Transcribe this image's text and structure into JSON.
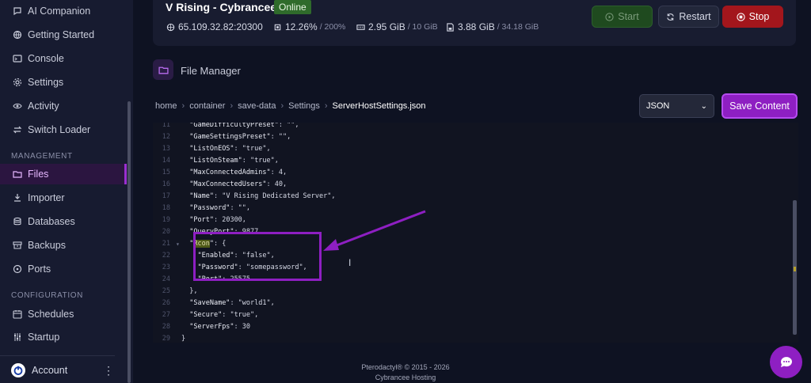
{
  "sidebar": {
    "items_top": [
      {
        "label": "AI Companion",
        "icon": "chat-icon"
      },
      {
        "label": "Getting Started",
        "icon": "globe-icon"
      },
      {
        "label": "Console",
        "icon": "terminal-icon"
      },
      {
        "label": "Settings",
        "icon": "gear-icon"
      },
      {
        "label": "Activity",
        "icon": "eye-icon"
      },
      {
        "label": "Switch Loader",
        "icon": "switch-icon"
      }
    ],
    "management_label": "MANAGEMENT",
    "items_management": [
      {
        "label": "Files",
        "icon": "folder-icon",
        "active": true
      },
      {
        "label": "Importer",
        "icon": "download-icon"
      },
      {
        "label": "Databases",
        "icon": "database-icon"
      },
      {
        "label": "Backups",
        "icon": "archive-icon"
      },
      {
        "label": "Ports",
        "icon": "network-icon"
      }
    ],
    "configuration_label": "CONFIGURATION",
    "items_configuration": [
      {
        "label": "Schedules",
        "icon": "calendar-icon"
      },
      {
        "label": "Startup",
        "icon": "sliders-icon"
      }
    ],
    "account_label": "Account"
  },
  "server": {
    "name": "V Rising - Cybrancee",
    "status": "Online",
    "address": "65.109.32.82:20300",
    "cpu": "12.26%",
    "cpu_limit": "/ 200%",
    "memory": "2.95 GiB",
    "memory_limit": "/ 10 GiB",
    "disk": "3.88 GiB",
    "disk_limit": "/ 34.18 GiB"
  },
  "buttons": {
    "start": "Start",
    "restart": "Restart",
    "stop": "Stop"
  },
  "file_manager": {
    "title": "File Manager",
    "breadcrumb": [
      "home",
      "container",
      "save-data",
      "Settings",
      "ServerHostSettings.json"
    ],
    "language": "JSON",
    "save_label": "Save Content"
  },
  "editor": {
    "lines": [
      {
        "n": "11",
        "text": "  \"GameDifficultyPreset\": \"\","
      },
      {
        "n": "12",
        "text": "  \"GameSettingsPreset\": \"\","
      },
      {
        "n": "13",
        "text": "  \"ListOnEOS\": \"true\","
      },
      {
        "n": "14",
        "text": "  \"ListOnSteam\": \"true\","
      },
      {
        "n": "15",
        "text": "  \"MaxConnectedAdmins\": 4,"
      },
      {
        "n": "16",
        "text": "  \"MaxConnectedUsers\": 40,"
      },
      {
        "n": "17",
        "text": "  \"Name\": \"V Rising Dedicated Server\","
      },
      {
        "n": "18",
        "text": "  \"Password\": \"\","
      },
      {
        "n": "19",
        "text": "  \"Port\": 20300,"
      },
      {
        "n": "20",
        "text": "  \"QueryPort\": 9877,"
      },
      {
        "n": "21",
        "text": "  \"Rcon\": {"
      },
      {
        "n": "22",
        "text": "    \"Enabled\": \"false\","
      },
      {
        "n": "23",
        "text": "    \"Password\": \"somepassword\","
      },
      {
        "n": "24",
        "text": "    \"Port\": 25575"
      },
      {
        "n": "25",
        "text": "  },"
      },
      {
        "n": "26",
        "text": "  \"SaveName\": \"world1\","
      },
      {
        "n": "27",
        "text": "  \"Secure\": \"true\","
      },
      {
        "n": "28",
        "text": "  \"ServerFps\": 30"
      },
      {
        "n": "29",
        "text": "}"
      }
    ]
  },
  "footer": {
    "line1": "Pterodactyl® © 2015 - 2026",
    "line2": "Cybrancee Hosting"
  },
  "colors": {
    "accent": "#8e1fc2",
    "online": "#2f6b2b",
    "stop": "#a3161c",
    "start": "#1f4a1f"
  }
}
